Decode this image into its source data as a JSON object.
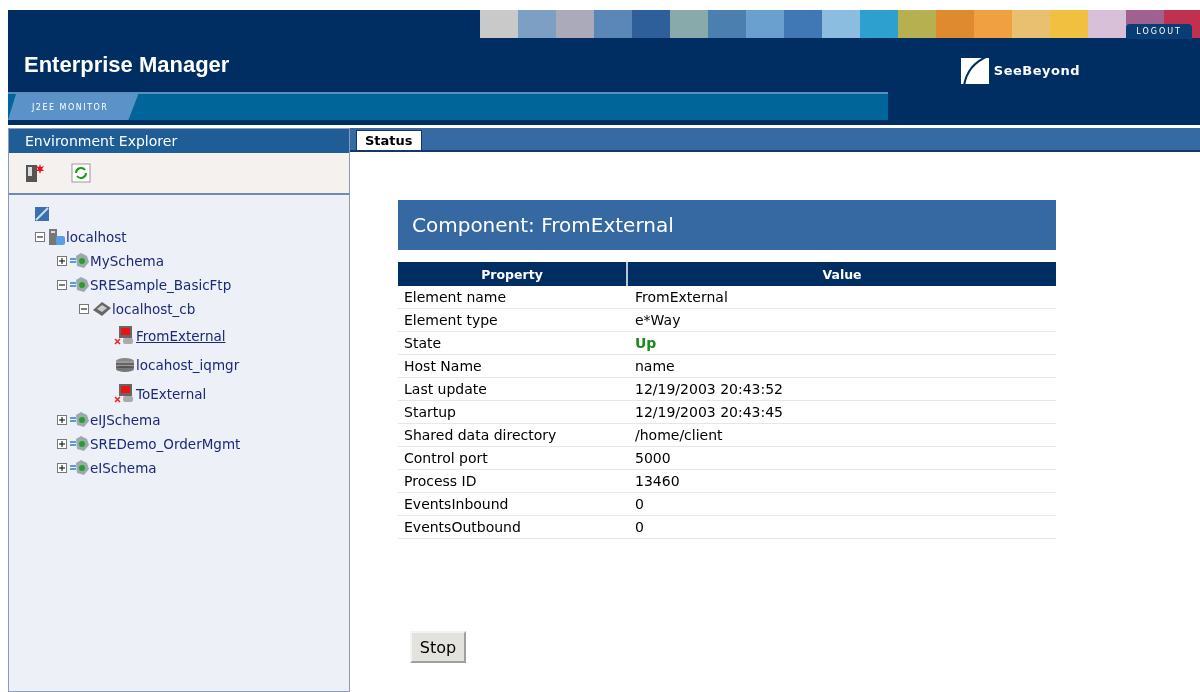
{
  "header": {
    "title": "Enterprise Manager",
    "section_tab": "J2EE MONITOR",
    "logout": "LOGOUT",
    "brand": "SeeBeyond"
  },
  "explorer": {
    "title": "Environment Explorer",
    "tree": [
      {
        "label": "localhost",
        "kind": "host",
        "expanded": true,
        "selected": false,
        "children": [
          {
            "label": "MySchema",
            "kind": "schema",
            "expanded": false,
            "selected": false
          },
          {
            "label": "SRESample_BasicFtp",
            "kind": "schema",
            "expanded": true,
            "selected": false,
            "children": [
              {
                "label": "localhost_cb",
                "kind": "domain",
                "expanded": true,
                "selected": false,
                "children": [
                  {
                    "label": "FromExternal",
                    "kind": "component",
                    "selected": true
                  },
                  {
                    "label": "locahost_iqmgr",
                    "kind": "queue",
                    "selected": false
                  },
                  {
                    "label": "ToExternal",
                    "kind": "component",
                    "selected": false
                  }
                ]
              }
            ]
          },
          {
            "label": "eIJSchema",
            "kind": "schema",
            "expanded": false,
            "selected": false
          },
          {
            "label": "SREDemo_OrderMgmt",
            "kind": "schema",
            "expanded": false,
            "selected": false
          },
          {
            "label": "eISchema",
            "kind": "schema",
            "expanded": false,
            "selected": false
          }
        ]
      }
    ]
  },
  "tabs": [
    {
      "label": "Status",
      "selected": true
    }
  ],
  "component": {
    "title": "Component: FromExternal",
    "columns": [
      "Property",
      "Value"
    ],
    "rows": [
      {
        "property": "Element name",
        "value": "FromExternal",
        "kind": "text"
      },
      {
        "property": "Element type",
        "value": "e*Way",
        "kind": "text"
      },
      {
        "property": "State",
        "value": "Up",
        "kind": "status"
      },
      {
        "property": "Host Name",
        "value": "name",
        "kind": "text"
      },
      {
        "property": "Last update",
        "value": "12/19/2003 20:43:52",
        "kind": "text"
      },
      {
        "property": "Startup",
        "value": "12/19/2003 20:43:45",
        "kind": "text"
      },
      {
        "property": "Shared data directory",
        "value": "/home/client",
        "kind": "text"
      },
      {
        "property": "Control port",
        "value": "5000",
        "kind": "text"
      },
      {
        "property": "Process ID",
        "value": "13460",
        "kind": "text"
      },
      {
        "property": "EventsInbound",
        "value": "0",
        "kind": "text"
      },
      {
        "property": "EventsOutbound",
        "value": "0",
        "kind": "text"
      }
    ]
  },
  "buttons": [
    "Stop"
  ]
}
